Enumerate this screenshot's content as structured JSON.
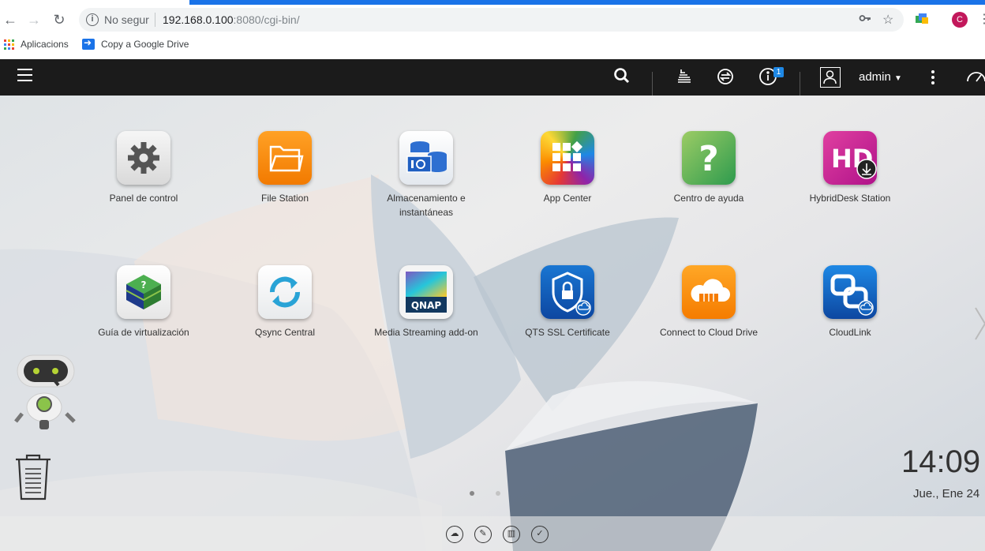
{
  "browser": {
    "insecure_label": "No segur",
    "url_host": "192.168.0.100",
    "url_port": ":8080",
    "url_path": "/cgi-bin/",
    "profile_initial": "C",
    "bookmarks": [
      {
        "label": "Aplicacions",
        "icon": "apps-grid-icon"
      },
      {
        "label": "Copy a Google Drive",
        "icon": "drive-arrow-icon"
      }
    ]
  },
  "topbar": {
    "username": "admin",
    "notification_count": "1",
    "icons": [
      "menu-icon",
      "search-icon",
      "task-stack-icon",
      "sync-icon",
      "info-icon",
      "user-icon",
      "more-vertical-icon",
      "dashboard-gauge-icon"
    ]
  },
  "apps": [
    {
      "label": "Panel de control",
      "icon": "gear-icon"
    },
    {
      "label": "File Station",
      "icon": "folder-icon"
    },
    {
      "label": "Almacenamiento e instantáneas",
      "icon": "storage-snapshot-icon"
    },
    {
      "label": "App Center",
      "icon": "app-grid-icon"
    },
    {
      "label": "Centro de ayuda",
      "icon": "help-icon"
    },
    {
      "label": "HybridDesk Station",
      "icon": "hd-icon"
    },
    {
      "label": "Guía de virtualización",
      "icon": "virtualization-cube-icon"
    },
    {
      "label": "Qsync Central",
      "icon": "sync-arrows-icon"
    },
    {
      "label": "Media Streaming add-on",
      "icon": "qnap-media-icon",
      "logo_text": "QNAP"
    },
    {
      "label": "QTS SSL Certificate",
      "icon": "shield-lock-icon"
    },
    {
      "label": "Connect to Cloud Drive",
      "icon": "cloud-icon"
    },
    {
      "label": "CloudLink",
      "icon": "cloudlink-icon"
    }
  ],
  "clock": {
    "time": "14:09",
    "date": "Jue., Ene 24"
  },
  "pager": {
    "pages": 2,
    "current": 1
  },
  "dock_icons": [
    "cloud-dock-icon",
    "tools-dock-icon",
    "book-dock-icon",
    "notes-dock-icon"
  ]
}
